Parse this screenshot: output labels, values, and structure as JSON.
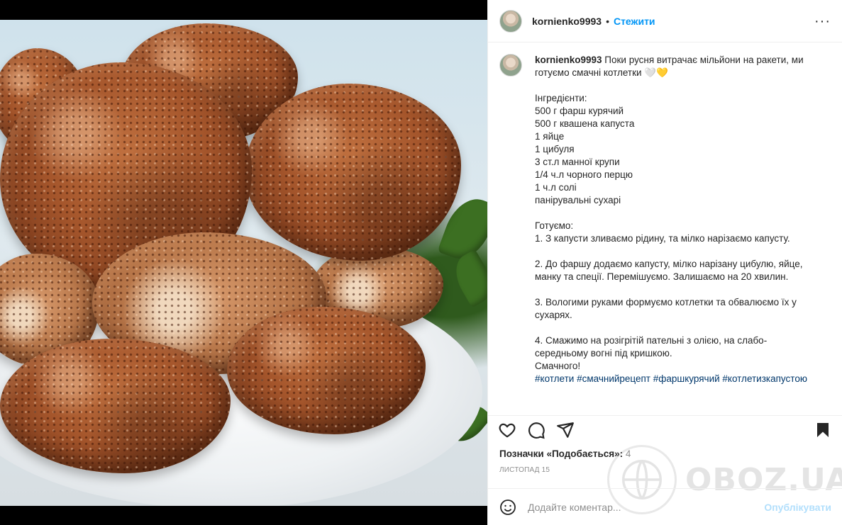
{
  "post": {
    "username": "kornienko9993",
    "separator": "•",
    "follow_label": "Стежити",
    "more_icon": "more-horizontal-icon",
    "more_glyph": "···"
  },
  "caption": {
    "username": "kornienko9993",
    "text": " Поки русня витрачає мільйони на ракети, ми готуємо смачні котлетки 🤍💛\n\nІнгредієнти:\n500 г фарш курячий\n500 г квашена капуста\n1 яйце\n1 цибуля\n3 ст.л манної крупи\n1/4 ч.л чорного перцю\n1 ч.л солі\nпанірувальні сухарі\n\nГотуємо:\n1. З капусти зливаємо рідину, та мілко нарізаємо капусту.\n\n2. До фаршу додаємо капусту, мілко нарізану цибулю, яйце, манку та спеції. Перемішуємо. Залишаємо на 20 хвилин.\n\n3. Вологими руками формуємо котлетки та обвалюємо їх у сухарях.\n\n4. Смажимо на розігрітій пательні з олією, на слабо-середньому вогні під кришкою.\nСмачного!\n",
    "hashtags": "#котлети #смачнийрецепт #фаршкурячий #котлетизкапустою"
  },
  "actions": {
    "like_icon": "heart-icon",
    "comment_icon": "comment-icon",
    "share_icon": "send-icon",
    "save_icon": "bookmark-icon"
  },
  "likes": {
    "label": "Позначки «Подобається»: ",
    "count": "4"
  },
  "date": "листопад 15",
  "watermark": {
    "text": "OBOZ.UA"
  },
  "comment": {
    "emoji_icon": "smile-icon",
    "placeholder": "Додайте коментар...",
    "publish_label": "Опублікувати"
  },
  "colors": {
    "accent": "#0095f6",
    "publish_disabled": "#b2dffc",
    "hashtag": "#00376b",
    "secondary_text": "#8e8e8e"
  }
}
